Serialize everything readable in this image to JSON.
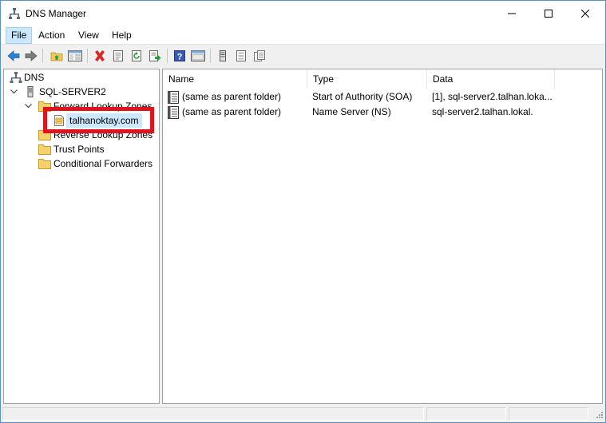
{
  "window": {
    "title": "DNS Manager",
    "app_icon": "dns-manager-icon"
  },
  "title_buttons": {
    "minimize": "minimize-icon",
    "maximize": "maximize-icon",
    "close": "close-icon"
  },
  "menu": [
    {
      "label": "File",
      "active": true
    },
    {
      "label": "Action",
      "active": false
    },
    {
      "label": "View",
      "active": false
    },
    {
      "label": "Help",
      "active": false
    }
  ],
  "toolbar": [
    "back-icon",
    "forward-icon",
    "up-folder-icon",
    "show-hide-console-tree-icon",
    "delete-icon",
    "properties-icon",
    "refresh-icon",
    "export-list-icon",
    "help-icon",
    "mmc-icon",
    "new-record-icon",
    "update-server-icon",
    "zone-icon"
  ],
  "tree": {
    "root": "DNS",
    "server": "SQL-SERVER2",
    "forward_zones": "Forward Lookup Zones",
    "selected_zone": "talhanoktay.com",
    "reverse_zones": "Reverse Lookup Zones",
    "trust_points": "Trust Points",
    "conditional_forwarders": "Conditional Forwarders"
  },
  "list": {
    "columns": [
      "Name",
      "Type",
      "Data"
    ],
    "rows": [
      {
        "name": "(same as parent folder)",
        "type": "Start of Authority (SOA)",
        "data": "[1], sql-server2.talhan.loka..."
      },
      {
        "name": "(same as parent folder)",
        "type": "Name Server (NS)",
        "data": "sql-server2.talhan.lokal."
      }
    ]
  },
  "colors": {
    "highlight_border": "#e0141e",
    "selection": "#cce8ff",
    "window_border": "#5a8fd0"
  }
}
